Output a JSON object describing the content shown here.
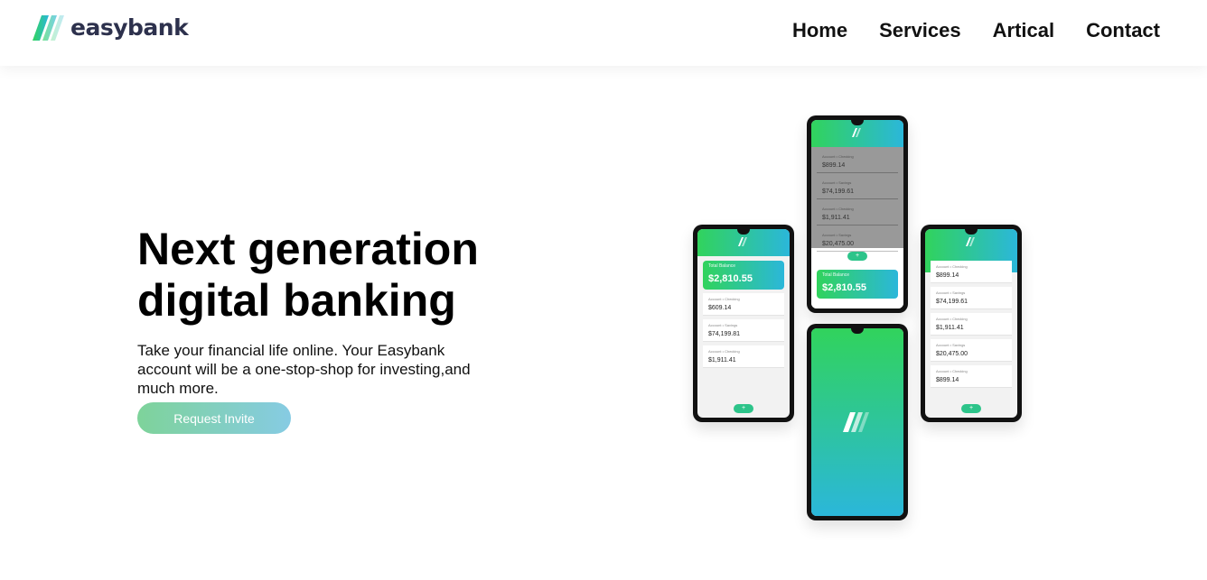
{
  "header": {
    "logo_text": "easybank",
    "nav": [
      "Home",
      "Services",
      "Artical",
      "Contact"
    ]
  },
  "hero": {
    "headline": "Next generation\ndigital banking",
    "subtext": "Take your financial life online. Your Easybank account will be a one-stop-shop for investing,and much more.",
    "cta_label": "Request Invite"
  },
  "phones": {
    "balance": "$2,810.55",
    "balance_label": "Total Balance",
    "accounts": [
      {
        "label": "Account • Checking",
        "amount": "$899.14"
      },
      {
        "label": "Account • Savings",
        "amount": "$74,199.61"
      },
      {
        "label": "Account • Checking",
        "amount": "$1,911.41"
      },
      {
        "label": "Account • Savings",
        "amount": "$20,475.00"
      },
      {
        "label": "Account • Checking",
        "amount": "$899.14"
      }
    ],
    "fab_icon": "+",
    "alt_accounts": [
      {
        "label": "Account • Checking",
        "amount": "$609.14"
      },
      {
        "label": "Account • Savings",
        "amount": "$74,199.81"
      },
      {
        "label": "Account • Checking",
        "amount": "$1,911.41"
      }
    ]
  },
  "colors": {
    "brand_dark": "#2d314d",
    "gradient_green": "#31d35c",
    "gradient_cyan": "#2bb7da"
  }
}
